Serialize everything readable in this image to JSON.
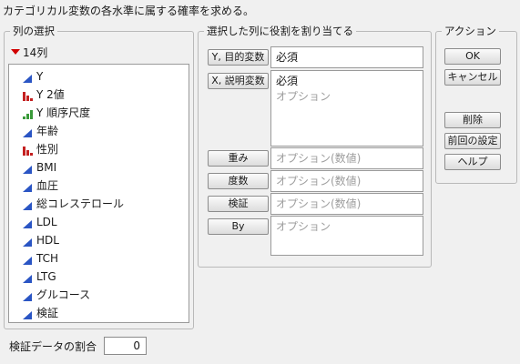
{
  "header": {
    "instruction": "カテゴリカル変数の各水準に属する確率を求める。"
  },
  "column_select": {
    "legend": "列の選択",
    "count_label": "14列",
    "columns": [
      {
        "label": "Y",
        "icon": "continuous-icon"
      },
      {
        "label": "Y 2値",
        "icon": "nominal-icon"
      },
      {
        "label": "Y 順序尺度",
        "icon": "ordinal-icon"
      },
      {
        "label": "年齢",
        "icon": "continuous-icon"
      },
      {
        "label": "性別",
        "icon": "nominal-icon"
      },
      {
        "label": "BMI",
        "icon": "continuous-icon"
      },
      {
        "label": "血圧",
        "icon": "continuous-icon"
      },
      {
        "label": "総コレステロール",
        "icon": "continuous-icon"
      },
      {
        "label": "LDL",
        "icon": "continuous-icon"
      },
      {
        "label": "HDL",
        "icon": "continuous-icon"
      },
      {
        "label": "TCH",
        "icon": "continuous-icon"
      },
      {
        "label": "LTG",
        "icon": "continuous-icon"
      },
      {
        "label": "グルコース",
        "icon": "continuous-icon"
      },
      {
        "label": "検証",
        "icon": "continuous-icon"
      }
    ]
  },
  "roles": {
    "legend": "選択した列に役割を割り当てる",
    "y_button": "Y, 目的変数",
    "y_required": "必須",
    "x_button": "X, 説明変数",
    "x_required": "必須",
    "x_optional": "オプション",
    "weight_button": "重み",
    "weight_placeholder": "オプション(数値)",
    "freq_button": "度数",
    "freq_placeholder": "オプション(数値)",
    "validation_button": "検証",
    "validation_placeholder": "オプション(数値)",
    "by_button": "By",
    "by_placeholder": "オプション"
  },
  "actions": {
    "legend": "アクション",
    "ok": "OK",
    "cancel": "キャンセル",
    "remove": "削除",
    "recall": "前回の設定",
    "help": "ヘルプ"
  },
  "validation_portion": {
    "label": "検証データの割合",
    "value": "0"
  },
  "colors": {
    "continuous": "#2a55c4",
    "nominal": "#c42020",
    "ordinal": "#3a9a3a",
    "red_triangle": "#d10000"
  }
}
